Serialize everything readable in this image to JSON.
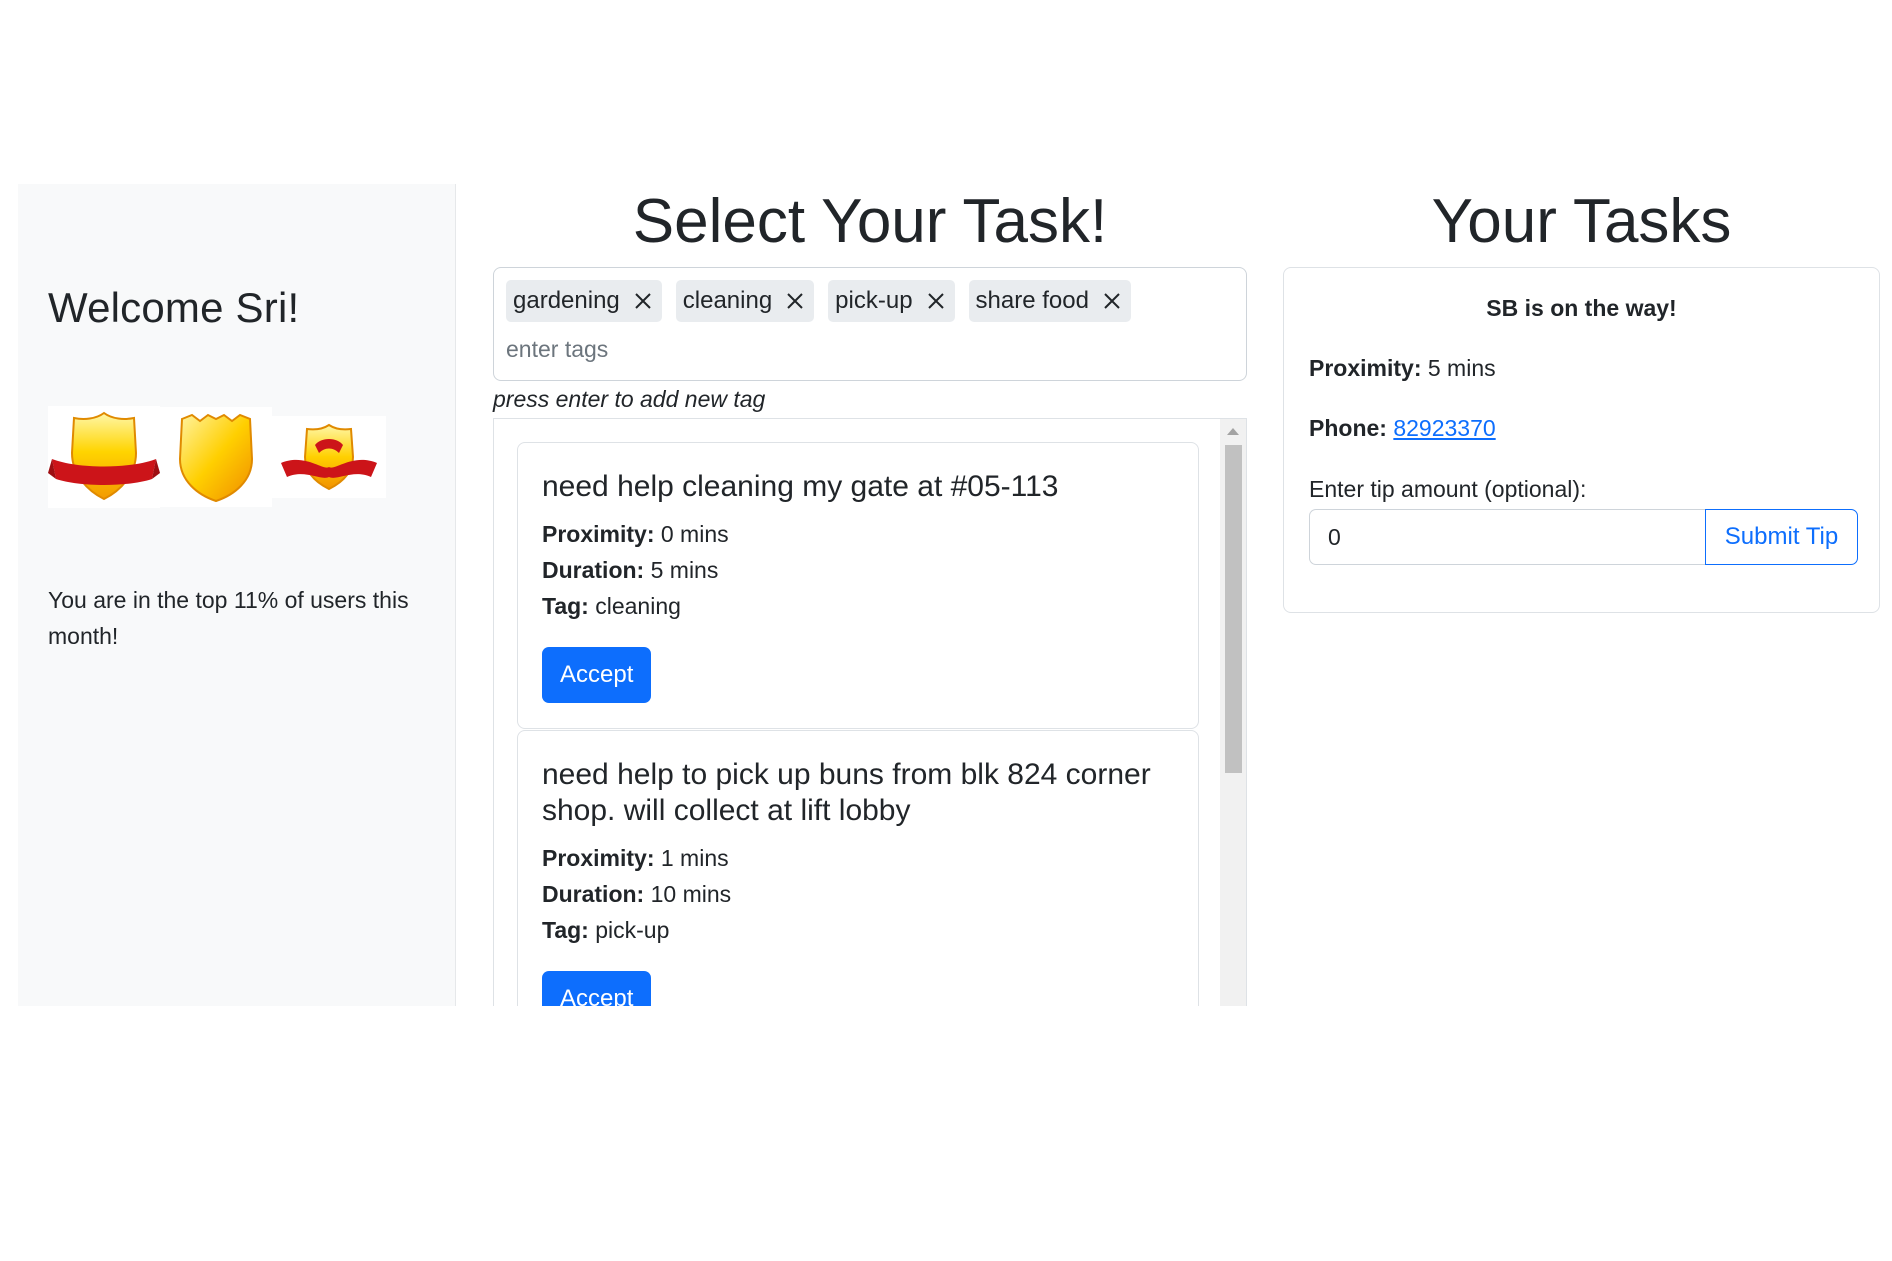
{
  "sidebar": {
    "welcome": "Welcome Sri!",
    "badges": [
      {
        "icon": "gold-shield-ribbon-badge-icon"
      },
      {
        "icon": "gold-shield-badge-icon"
      },
      {
        "icon": "small-shield-ribbon-badge-icon"
      }
    ],
    "rank_text": "You are in the top 11% of users this month!"
  },
  "tasks_panel": {
    "title": "Select Your Task!",
    "tags": [
      {
        "label": "gardening"
      },
      {
        "label": "cleaning"
      },
      {
        "label": "pick-up"
      },
      {
        "label": "share food"
      }
    ],
    "tag_input_placeholder": "enter tags",
    "hint": "press enter to add new tag",
    "labels": {
      "proximity": "Proximity:",
      "duration": "Duration:",
      "tag": "Tag:"
    },
    "tasks": [
      {
        "title": "need help cleaning my gate at #05-113",
        "proximity": "0 mins",
        "duration": "5 mins",
        "tag": "cleaning",
        "button": "Accept"
      },
      {
        "title": "need help to pick up buns from blk 824 corner shop. will collect at lift lobby",
        "proximity": "1 mins",
        "duration": "10 mins",
        "tag": "pick-up",
        "button": "Accept"
      }
    ]
  },
  "your_tasks": {
    "title": "Your Tasks",
    "status": "SB is on the way!",
    "proximity_label": "Proximity:",
    "proximity": "5 mins",
    "phone_label": "Phone:",
    "phone": "82923370",
    "tip_label": "Enter tip amount (optional):",
    "tip_value": "0",
    "submit_label": "Submit Tip"
  },
  "colors": {
    "primary": "#0d6efd",
    "sidebar_bg": "#f8f9fa",
    "chip_bg": "#e9ecef",
    "badge_gold": "#f5c400",
    "badge_ribbon": "#d0151b"
  }
}
